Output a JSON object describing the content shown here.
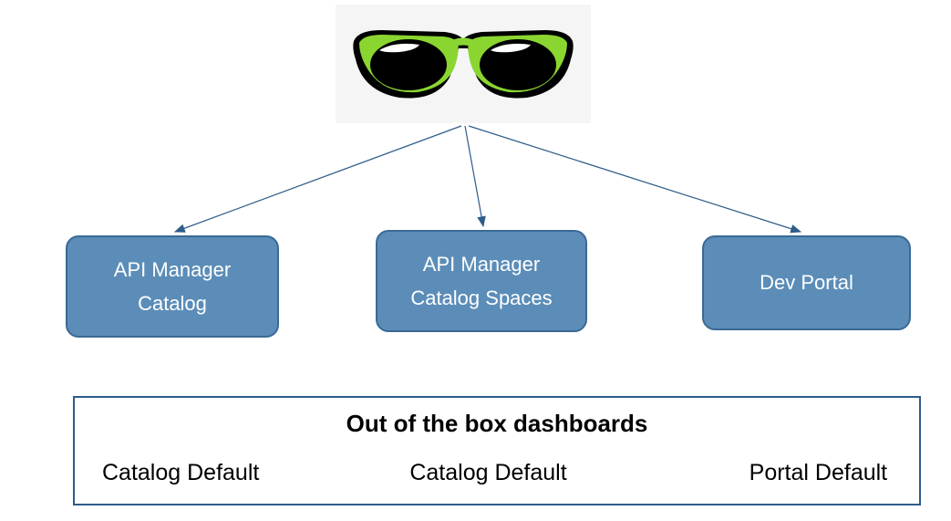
{
  "top_icon": "sunglasses-icon",
  "nodes": [
    {
      "line1": "API Manager",
      "line2": "Catalog"
    },
    {
      "line1": "API Manager",
      "line2": "Catalog Spaces"
    },
    {
      "line1": "Dev Portal",
      "line2": ""
    }
  ],
  "bottom": {
    "title": "Out of the box dashboards",
    "columns": [
      "Catalog Default",
      "Catalog Default",
      "Portal Default"
    ]
  },
  "colors": {
    "node_fill": "#5b8db8",
    "node_border": "#3a6a95",
    "arrow": "#2e5c8a",
    "bottom_border": "#2e5c8a",
    "sunglasses_frame": "#8bd531",
    "sunglasses_outline": "#000000"
  }
}
